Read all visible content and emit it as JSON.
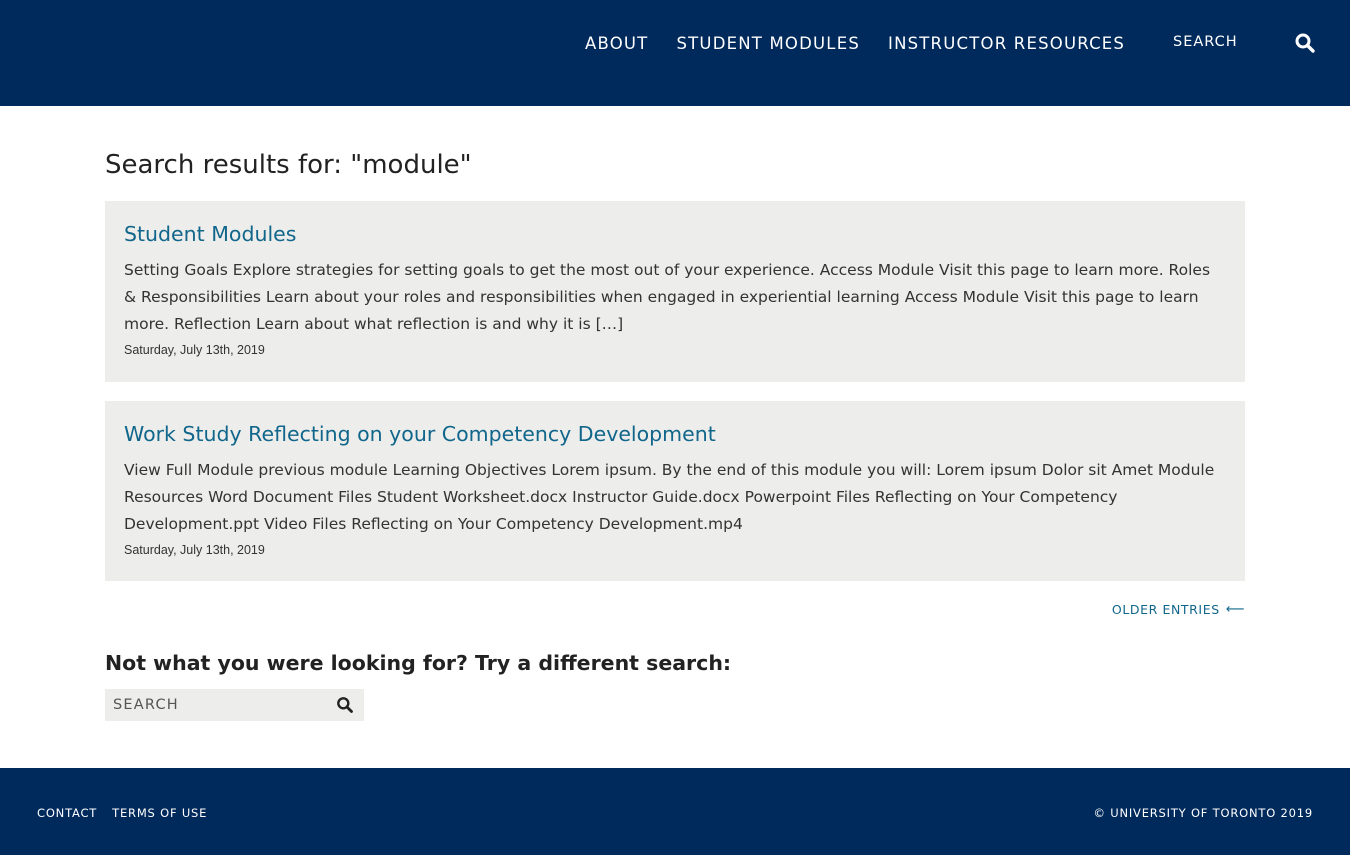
{
  "header": {
    "nav": [
      {
        "label": "ABOUT"
      },
      {
        "label": "STUDENT MODULES"
      },
      {
        "label": "INSTRUCTOR RESOURCES"
      }
    ],
    "search_label": "SEARCH",
    "search_icon": "search-icon"
  },
  "main": {
    "title": "Search results for: \"module\"",
    "results": [
      {
        "title": "Student Modules",
        "excerpt": "Setting Goals Explore strategies for setting goals to get the most out of your experience. Access Module Visit this page to learn more. Roles & Responsibilities Learn about your roles and responsibilities when engaged in experiential learning Access Module Visit this page to learn more. Reflection Learn about what reflection is and why it is […]",
        "date": "Saturday, July 13th, 2019"
      },
      {
        "title": "Work Study Reflecting on your Competency Development",
        "excerpt": "View Full Module previous module Learning Objectives Lorem ipsum. By the end of this module you will: Lorem ipsum Dolor sit Amet Module Resources Word Document Files Student Worksheet.docx Instructor Guide.docx Powerpoint Files Reflecting on Your Competency Development.ppt Video Files Reflecting on Your Competency Development.mp4",
        "date": "Saturday, July 13th, 2019"
      }
    ],
    "older_entries": "OLDER ENTRIES",
    "not_found_text": "Not what you were looking for? Try a different search:",
    "search_placeholder": "SEARCH"
  },
  "footer": {
    "links": [
      {
        "label": "CONTACT"
      },
      {
        "label": "TERMS OF USE"
      }
    ],
    "copyright": "© UNIVERSITY OF TORONTO 2019"
  },
  "colors": {
    "brand_navy": "#002a5c",
    "link_blue": "#11668b",
    "card_bg": "#ededeb"
  }
}
